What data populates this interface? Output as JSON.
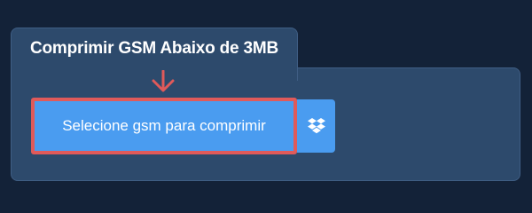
{
  "widget": {
    "title": "Comprimir GSM Abaixo de 3MB",
    "upload_button_label": "Selecione gsm para comprimir",
    "dropbox_icon": "dropbox-icon",
    "arrow_icon": "arrow-down-icon"
  },
  "colors": {
    "page_background": "#132238",
    "panel_background": "#2d4a6c",
    "button_background": "#4a9cf0",
    "highlight_border": "#e05a5a",
    "text": "#ffffff"
  }
}
